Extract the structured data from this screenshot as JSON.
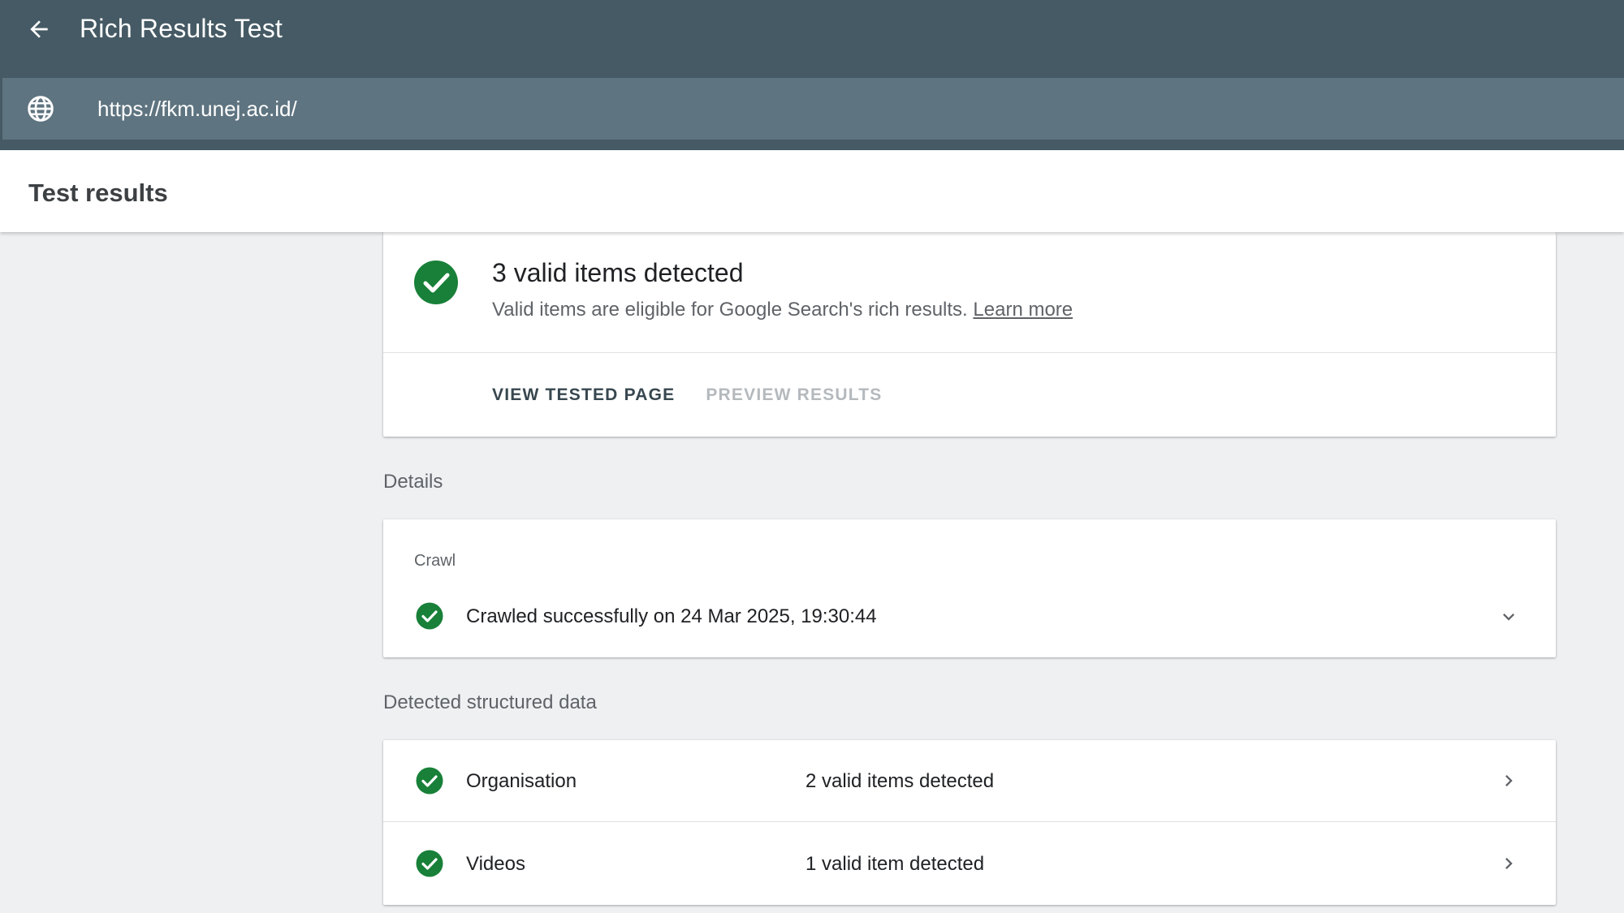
{
  "app": {
    "title": "Rich Results Test",
    "back_icon": "arrow-back-icon",
    "header_color": "#455a64"
  },
  "url_bar": {
    "icon": "globe-icon",
    "value": "https://fkm.unej.ac.id/"
  },
  "results_header": {
    "title": "Test results"
  },
  "summary": {
    "icon": "check-circle-icon",
    "title": "3 valid items detected",
    "subtitle": "Valid items are eligible for Google Search's rich results.",
    "learn_more": "Learn more",
    "actions": {
      "view_tested_page": "VIEW TESTED PAGE",
      "preview_results": "PREVIEW RESULTS"
    },
    "success_color": "#188038"
  },
  "details": {
    "section_label": "Details",
    "crawl": {
      "caption": "Crawl",
      "status": "Crawled successfully on 24 Mar 2025, 19:30:44",
      "icon": "check-circle-icon",
      "expand_icon": "chevron-down-icon"
    }
  },
  "structured_data": {
    "section_label": "Detected structured data",
    "items": [
      {
        "name": "Organisation",
        "status": "2 valid items detected",
        "icon": "check-circle-icon",
        "nav_icon": "chevron-right-icon"
      },
      {
        "name": "Videos",
        "status": "1 valid item detected",
        "icon": "check-circle-icon",
        "nav_icon": "chevron-right-icon"
      }
    ]
  }
}
